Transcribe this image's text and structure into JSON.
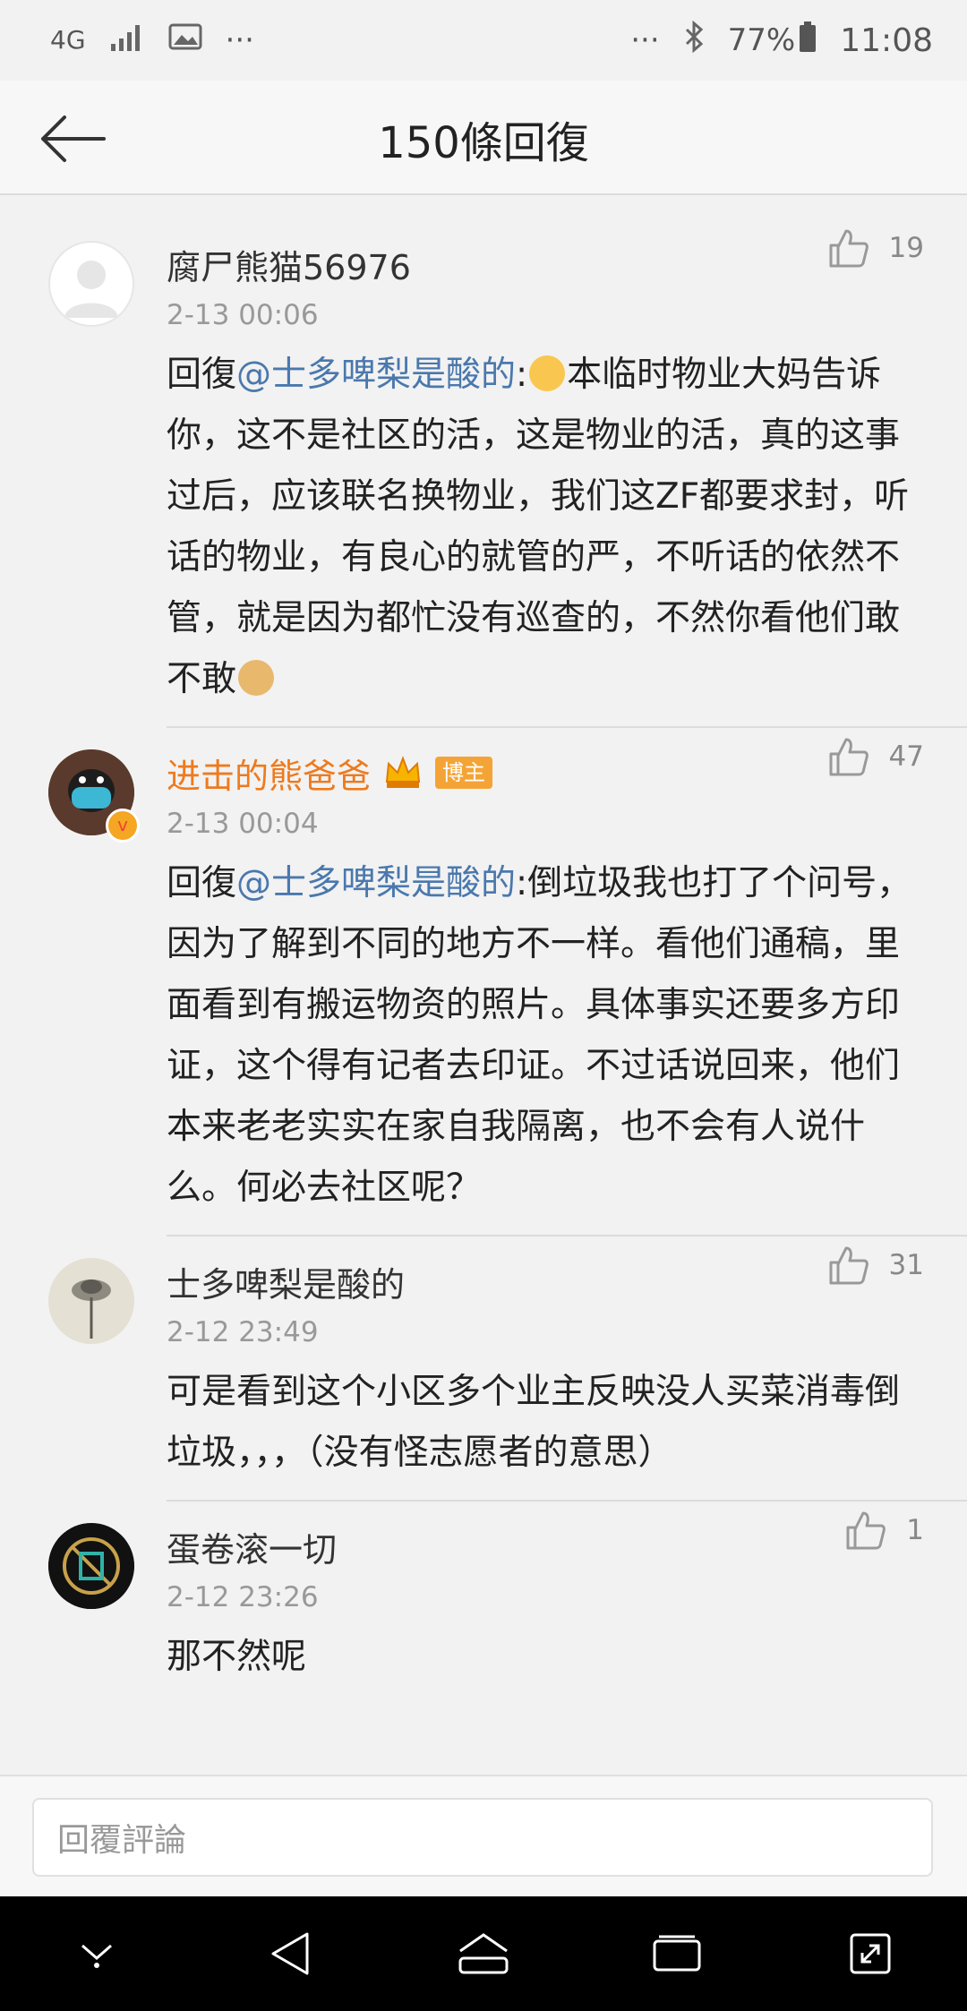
{
  "status_bar": {
    "network": "4G",
    "battery": "77%",
    "time": "11:08"
  },
  "header": {
    "title": "150條回復"
  },
  "comments": [
    {
      "name": "腐尸熊猫56976",
      "time": "2-13 00:06",
      "likes": "19",
      "reply_prefix": "回復",
      "mention": "@士多啤梨是酸的",
      "text_a": ":",
      "text_b": "本临时物业大妈告诉你，这不是社区的活，这是物业的活，真的这事过后，应该联名换物业，我们这ZF都要求封，听话的物业，有良心的就管的严，不听话的依然不管，就是因为都忙没有巡查的，不然你看他们敢不敢"
    },
    {
      "name": "进击的熊爸爸",
      "badge": "博主",
      "time": "2-13 00:04",
      "likes": "47",
      "reply_prefix": "回復",
      "mention": "@士多啤梨是酸的",
      "text": ":倒垃圾我也打了个问号，因为了解到不同的地方不一样。看他们通稿，里面看到有搬运物资的照片。具体事实还要多方印证，这个得有记者去印证。不过话说回来，他们本来老老实实在家自我隔离，也不会有人说什么。何必去社区呢？"
    },
    {
      "name": "士多啤梨是酸的",
      "time": "2-12 23:49",
      "likes": "31",
      "text": "可是看到这个小区多个业主反映没人买菜消毒倒垃圾，，，（没有怪志愿者的意思）"
    },
    {
      "name": "蛋卷滚一切",
      "time": "2-12 23:26",
      "likes": "1",
      "text": "那不然呢"
    }
  ],
  "reply_bar": {
    "placeholder": "回覆評論"
  },
  "colors": {
    "mention": "#4a78ad",
    "vip_name": "#ee7a1d",
    "badge": "#f4a436"
  }
}
